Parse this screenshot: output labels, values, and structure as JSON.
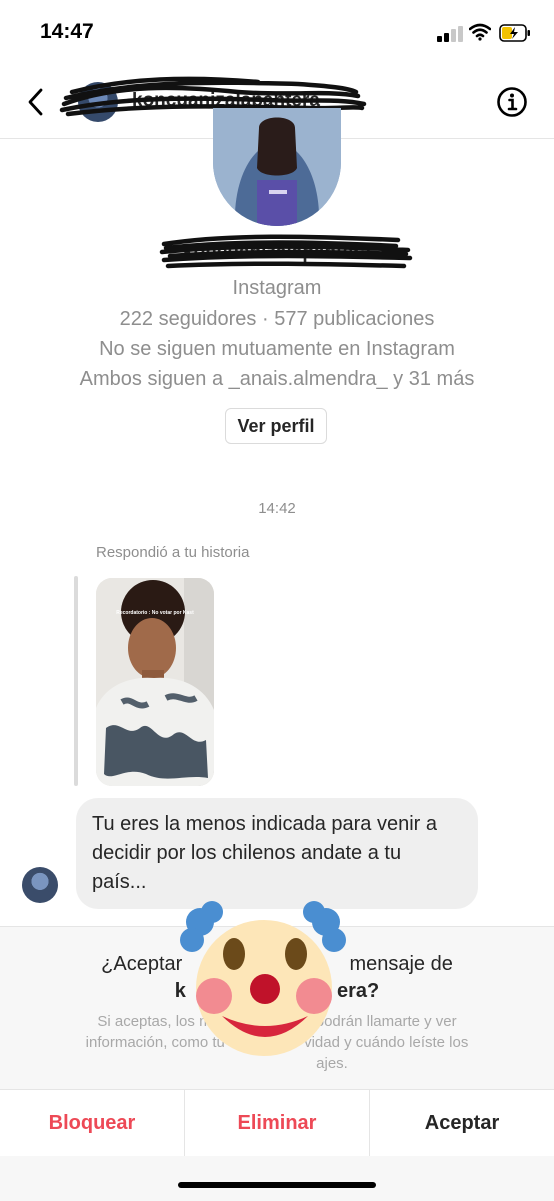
{
  "status_bar": {
    "time": "14:47"
  },
  "header": {
    "username": "koncuanizalapantera"
  },
  "profile": {
    "name": "koncuanizalapantera",
    "platform": "Instagram",
    "followers_line": "222 seguidores · 577 publicaciones",
    "mutual_line": "No se siguen mutuamente en Instagram",
    "common_line": "Ambos siguen a _anais.almendra_ y 31 más",
    "view_profile_label": "Ver perfil"
  },
  "chat": {
    "timestamp": "14:42",
    "reply_label": "Respondió a tu historia",
    "story_caption": "Recordatorio : No votar por Kast",
    "message": "Tu eres la menos indicada para venir a decidir por los chilenos andate a tu país..."
  },
  "request": {
    "question_prefix": "¿Aceptar",
    "question_suffix": "mensaje de",
    "handle_start": "k",
    "handle_end": "era?",
    "note_line1": "Si aceptas, los m                         podrán llamarte y ver",
    "note_line2": "información, como tu                   vidad y cuándo leíste los",
    "note_line3": "ajes."
  },
  "actions": {
    "block": "Bloquear",
    "delete": "Eliminar",
    "accept": "Aceptar"
  },
  "colors": {
    "danger": "#ed4956",
    "secondary_text": "#8e8e8e",
    "bubble": "#efefef"
  },
  "icons": {
    "back": "chevron-left-icon",
    "info": "info-circle-icon",
    "overlay": "clown-face-emoji"
  }
}
